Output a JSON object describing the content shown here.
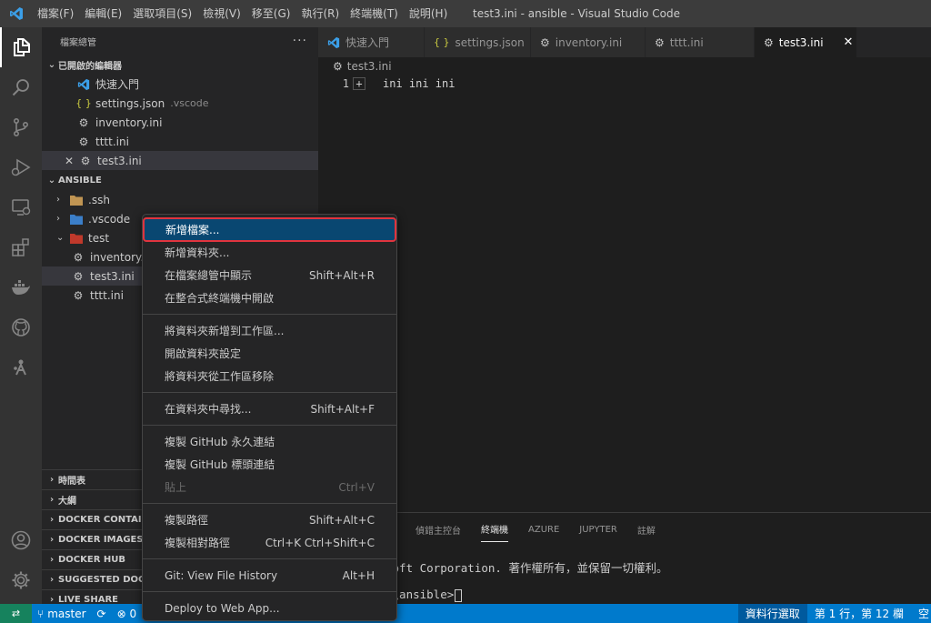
{
  "window": {
    "title": "test3.ini - ansible - Visual Studio Code",
    "menu": [
      "檔案(F)",
      "編輯(E)",
      "選取項目(S)",
      "檢視(V)",
      "移至(G)",
      "執行(R)",
      "終端機(T)",
      "說明(H)"
    ]
  },
  "activity_bar": [
    "explorer-icon",
    "search-icon",
    "source-control-icon",
    "run-debug-icon",
    "remote-explorer-icon",
    "extensions-icon",
    "docker-icon",
    "github-icon",
    "ansible-icon",
    "account-icon",
    "settings-gear-icon"
  ],
  "sidebar": {
    "title": "檔案總管",
    "more": "···",
    "open_editors": {
      "label": "已開啟的編輯器",
      "items": [
        {
          "name": "快速入門",
          "icon": "vscode-icon",
          "desc": ""
        },
        {
          "name": "settings.json",
          "icon": "json-icon",
          "desc": ".vscode"
        },
        {
          "name": "inventory.ini",
          "icon": "gear-icon",
          "desc": ""
        },
        {
          "name": "tttt.ini",
          "icon": "gear-icon",
          "desc": ""
        },
        {
          "name": "test3.ini",
          "icon": "gear-icon",
          "desc": ""
        }
      ]
    },
    "workspace": {
      "label": "ANSIBLE",
      "items": [
        {
          "name": ".ssh",
          "type": "folder"
        },
        {
          "name": ".vscode",
          "type": "folder"
        },
        {
          "name": "test",
          "type": "folder"
        },
        {
          "name": "inventory.i",
          "type": "file"
        },
        {
          "name": "test3.ini",
          "type": "file"
        },
        {
          "name": "tttt.ini",
          "type": "file"
        }
      ]
    },
    "bottom_sections": [
      "時間表",
      "大綱",
      "DOCKER CONTAIN",
      "DOCKER IMAGES",
      "DOCKER HUB",
      "SUGGESTED DOCK",
      "LIVE SHARE"
    ]
  },
  "tabs": [
    {
      "label": "快速入門",
      "icon": "vscode-icon"
    },
    {
      "label": "settings.json",
      "icon": "json-icon"
    },
    {
      "label": "inventory.ini",
      "icon": "gear-icon"
    },
    {
      "label": "tttt.ini",
      "icon": "gear-icon"
    },
    {
      "label": "test3.ini",
      "icon": "gear-icon",
      "active": true,
      "close": "✕"
    }
  ],
  "editor": {
    "breadcrumb": "test3.ini",
    "line_number": "1",
    "plus": "+",
    "code": "ini ini ini"
  },
  "panel": {
    "tabs": [
      "偵錯主控台",
      "終端機",
      "AZURE",
      "JUPYTER",
      "註解"
    ],
    "active_tab": "終端機",
    "line1": "soft Corporation. 著作權所有，並保留一切權利。",
    "line2": "e\\ansible>"
  },
  "status_bar": {
    "remote": "⇄",
    "branch": "master",
    "sync": "⟳",
    "errors": "⊗ 0",
    "selection_mode": "資料行選取",
    "position": "第 1 行，第 12 欄",
    "spaces": "空"
  },
  "context_menu": {
    "groups": [
      [
        {
          "label": "新增檔案...",
          "shortcut": "",
          "highlighted": true
        },
        {
          "label": "新增資料夾...",
          "shortcut": ""
        },
        {
          "label": "在檔案總管中顯示",
          "shortcut": "Shift+Alt+R"
        },
        {
          "label": "在整合式終端機中開啟",
          "shortcut": ""
        }
      ],
      [
        {
          "label": "將資料夾新增到工作區...",
          "shortcut": ""
        },
        {
          "label": "開啟資料夾設定",
          "shortcut": ""
        },
        {
          "label": "將資料夾從工作區移除",
          "shortcut": ""
        }
      ],
      [
        {
          "label": "在資料夾中尋找...",
          "shortcut": "Shift+Alt+F"
        }
      ],
      [
        {
          "label": "複製 GitHub 永久連結",
          "shortcut": ""
        },
        {
          "label": "複製 GitHub 標頭連結",
          "shortcut": ""
        },
        {
          "label": "貼上",
          "shortcut": "Ctrl+V",
          "disabled": true
        }
      ],
      [
        {
          "label": "複製路徑",
          "shortcut": "Shift+Alt+C"
        },
        {
          "label": "複製相對路徑",
          "shortcut": "Ctrl+K Ctrl+Shift+C"
        }
      ],
      [
        {
          "label": "Git: View File History",
          "shortcut": "Alt+H"
        }
      ],
      [
        {
          "label": "Deploy to Web App...",
          "shortcut": ""
        }
      ]
    ]
  },
  "colors": {
    "accent": "#007acc",
    "remote": "#16825d",
    "menu_highlight": "#094771",
    "highlight_outline": "#e0343e",
    "vscode_blue": "#3b9fe8",
    "json_yellow": "#cbcb41"
  }
}
